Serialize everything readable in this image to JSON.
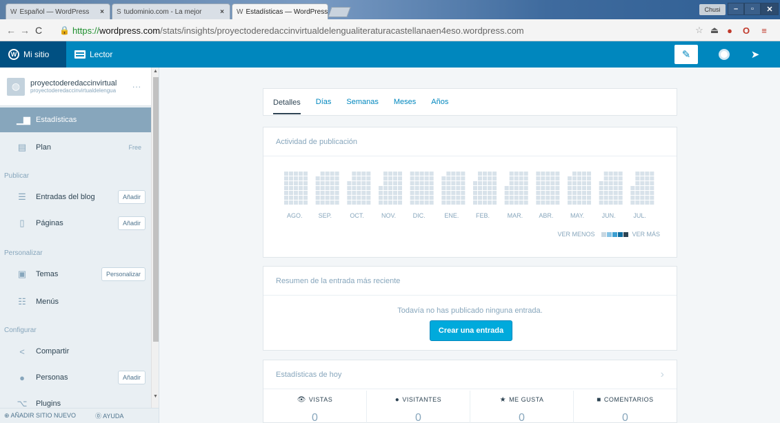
{
  "browser": {
    "tabs": [
      {
        "title": "Español — WordPress",
        "favicon": "W"
      },
      {
        "title": "tudominio.com - La mejor",
        "favicon": "S"
      },
      {
        "title": "Estadísticas — WordPress",
        "favicon": "W"
      }
    ],
    "window_user": "Chusi",
    "url": {
      "scheme": "https://",
      "host": "wordpress.com",
      "path": "/stats/insights/proyectoderedaccinvirtualdelengualiteraturacastellanaen4eso.wordpress.com"
    }
  },
  "masterbar": {
    "my_site": "Mi sitio",
    "reader": "Lector"
  },
  "sidebar": {
    "site": {
      "name": "proyectoderedaccinvirtual",
      "url": "proyectoderedaccinvirtualdelengua",
      "more": "..."
    },
    "items": [
      {
        "label": "Estadísticas",
        "icon": "stats-icon"
      },
      {
        "label": "Plan",
        "icon": "plan-icon",
        "extra": "Free"
      }
    ],
    "sections": {
      "publish": "Publicar",
      "personalize": "Personalizar",
      "configure": "Configurar"
    },
    "publish_items": [
      {
        "label": "Entradas del blog",
        "button": "Añadir"
      },
      {
        "label": "Páginas",
        "button": "Añadir"
      }
    ],
    "personalize_items": [
      {
        "label": "Temas",
        "button": "Personalizar"
      },
      {
        "label": "Menús"
      }
    ],
    "configure_items": [
      {
        "label": "Compartir"
      },
      {
        "label": "Personas",
        "button": "Añadir"
      },
      {
        "label": "Plugins"
      }
    ],
    "footer": {
      "add_site": "AÑADIR SITIO NUEVO",
      "help": "AYUDA"
    }
  },
  "stats": {
    "tabs": [
      "Detalles",
      "Días",
      "Semanas",
      "Meses",
      "Años"
    ],
    "active_tab": "Detalles",
    "activity": {
      "title": "Actividad de publicación",
      "months": [
        "AGO.",
        "SEP.",
        "OCT.",
        "NOV.",
        "DIC.",
        "ENE.",
        "FEB.",
        "MAR.",
        "ABR.",
        "MAY.",
        "JUN.",
        "JUL."
      ],
      "legend_less": "VER MENOS",
      "legend_more": "VER MÁS",
      "empty_color": "#d8e2ea",
      "legend_colors": [
        "#c8d7e1",
        "#87c3e5",
        "#3d9fd1",
        "#0f6ea0",
        "#2e4453"
      ]
    },
    "recent": {
      "title": "Resumen de la entrada más reciente",
      "empty_text": "Todavía no has publicado ninguna entrada.",
      "cta": "Crear una entrada"
    },
    "today": {
      "title": "Estadísticas de hoy",
      "columns": [
        {
          "label": "VISTAS",
          "icon": "eye-icon",
          "value": "0"
        },
        {
          "label": "VISITANTES",
          "icon": "person-icon",
          "value": "0"
        },
        {
          "label": "ME GUSTA",
          "icon": "star-icon",
          "value": "0"
        },
        {
          "label": "COMENTARIOS",
          "icon": "comment-icon",
          "value": "0"
        }
      ]
    }
  },
  "colors": {
    "masterbar": "#0087be",
    "accent_button": "#00aadc",
    "sidebar_selected": "#87a6bc"
  }
}
